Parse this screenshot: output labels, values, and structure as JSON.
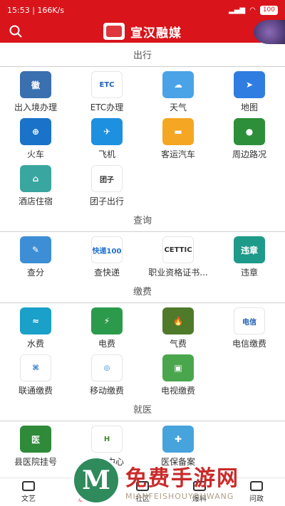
{
  "status_bar": {
    "time": "15:53",
    "speed": "166K/s",
    "battery": "100"
  },
  "header": {
    "title": "宣汉融媒"
  },
  "sections": [
    {
      "title": "出行",
      "items": [
        {
          "label": "出入境办理",
          "icon": "emblem-icon",
          "color": "#3a6fb0",
          "glyph": "徽"
        },
        {
          "label": "ETC办理",
          "icon": "etc-icon",
          "color": "#ffffff",
          "glyph": "ETC",
          "text_color": "#1f5fb3"
        },
        {
          "label": "天气",
          "icon": "cloud-rain-icon",
          "color": "#4aa3e6",
          "glyph": "☁"
        },
        {
          "label": "地图",
          "icon": "map-navigation-icon",
          "color": "#2f7de1",
          "glyph": "➤"
        },
        {
          "label": "火车",
          "icon": "train-icon",
          "color": "#1a73c9",
          "glyph": "⊕"
        },
        {
          "label": "飞机",
          "icon": "airplane-icon",
          "color": "#1e90e0",
          "glyph": "✈"
        },
        {
          "label": "客运汽车",
          "icon": "bus-icon",
          "color": "#f5a623",
          "glyph": "▬"
        },
        {
          "label": "周边路况",
          "icon": "traffic-light-icon",
          "color": "#2d8f3a",
          "glyph": "●"
        },
        {
          "label": "酒店住宿",
          "icon": "hotel-icon",
          "color": "#3aa6a0",
          "glyph": "⌂"
        },
        {
          "label": "团子出行",
          "icon": "tuanzi-icon",
          "color": "#ffffff",
          "glyph": "团子",
          "text_color": "#333333"
        }
      ]
    },
    {
      "title": "查询",
      "items": [
        {
          "label": "查分",
          "icon": "score-doc-icon",
          "color": "#3e8ed6",
          "glyph": "✎"
        },
        {
          "label": "查快递",
          "icon": "express-icon",
          "color": "#ffffff",
          "glyph": "快递100",
          "text_color": "#1f6fcf"
        },
        {
          "label": "职业资格证书...",
          "icon": "certificate-icon",
          "color": "#ffffff",
          "glyph": "CETTIC",
          "text_color": "#333333"
        },
        {
          "label": "违章",
          "icon": "violation-icon",
          "color": "#1d9a8a",
          "glyph": "违章"
        }
      ]
    },
    {
      "title": "缴费",
      "items": [
        {
          "label": "水费",
          "icon": "water-icon",
          "color": "#1aa0c9",
          "glyph": "≈"
        },
        {
          "label": "电费",
          "icon": "electricity-icon",
          "color": "#2c9a4b",
          "glyph": "⚡"
        },
        {
          "label": "气费",
          "icon": "gas-icon",
          "color": "#4f7a2a",
          "glyph": "🔥"
        },
        {
          "label": "电信缴费",
          "icon": "telecom-icon",
          "color": "#ffffff",
          "glyph": "电信",
          "text_color": "#1e5fb5"
        },
        {
          "label": "联通缴费",
          "icon": "unicom-icon",
          "color": "#ffffff",
          "glyph": "⌘",
          "text_color": "#1e6fcc"
        },
        {
          "label": "移动缴费",
          "icon": "mobile-icon",
          "color": "#ffffff",
          "glyph": "◎",
          "text_color": "#1e7fcf"
        },
        {
          "label": "电视缴费",
          "icon": "tv-icon",
          "color": "#4aa64d",
          "glyph": "▣"
        }
      ]
    },
    {
      "title": "就医",
      "items": [
        {
          "label": "县医院挂号",
          "icon": "hospital-icon",
          "color": "#2f8a3a",
          "glyph": "医"
        },
        {
          "label": "体检中心",
          "icon": "health-check-icon",
          "color": "#ffffff",
          "glyph": "H",
          "text_color": "#3d8a2a"
        },
        {
          "label": "医保备案",
          "icon": "medical-kit-icon",
          "color": "#47a3dc",
          "glyph": "✚"
        }
      ]
    }
  ],
  "bottom_nav": [
    {
      "label": "文艺",
      "icon": "book-icon"
    },
    {
      "label": "服务",
      "icon": "service-icon",
      "active": true
    },
    {
      "label": "社区",
      "icon": "community-icon"
    },
    {
      "label": "爆料",
      "icon": "report-icon"
    },
    {
      "label": "问政",
      "icon": "question-icon"
    }
  ],
  "watermark": {
    "main": "免费手游网",
    "sub": "MIANFEISHOUYOUWANG",
    "mark": "M"
  }
}
